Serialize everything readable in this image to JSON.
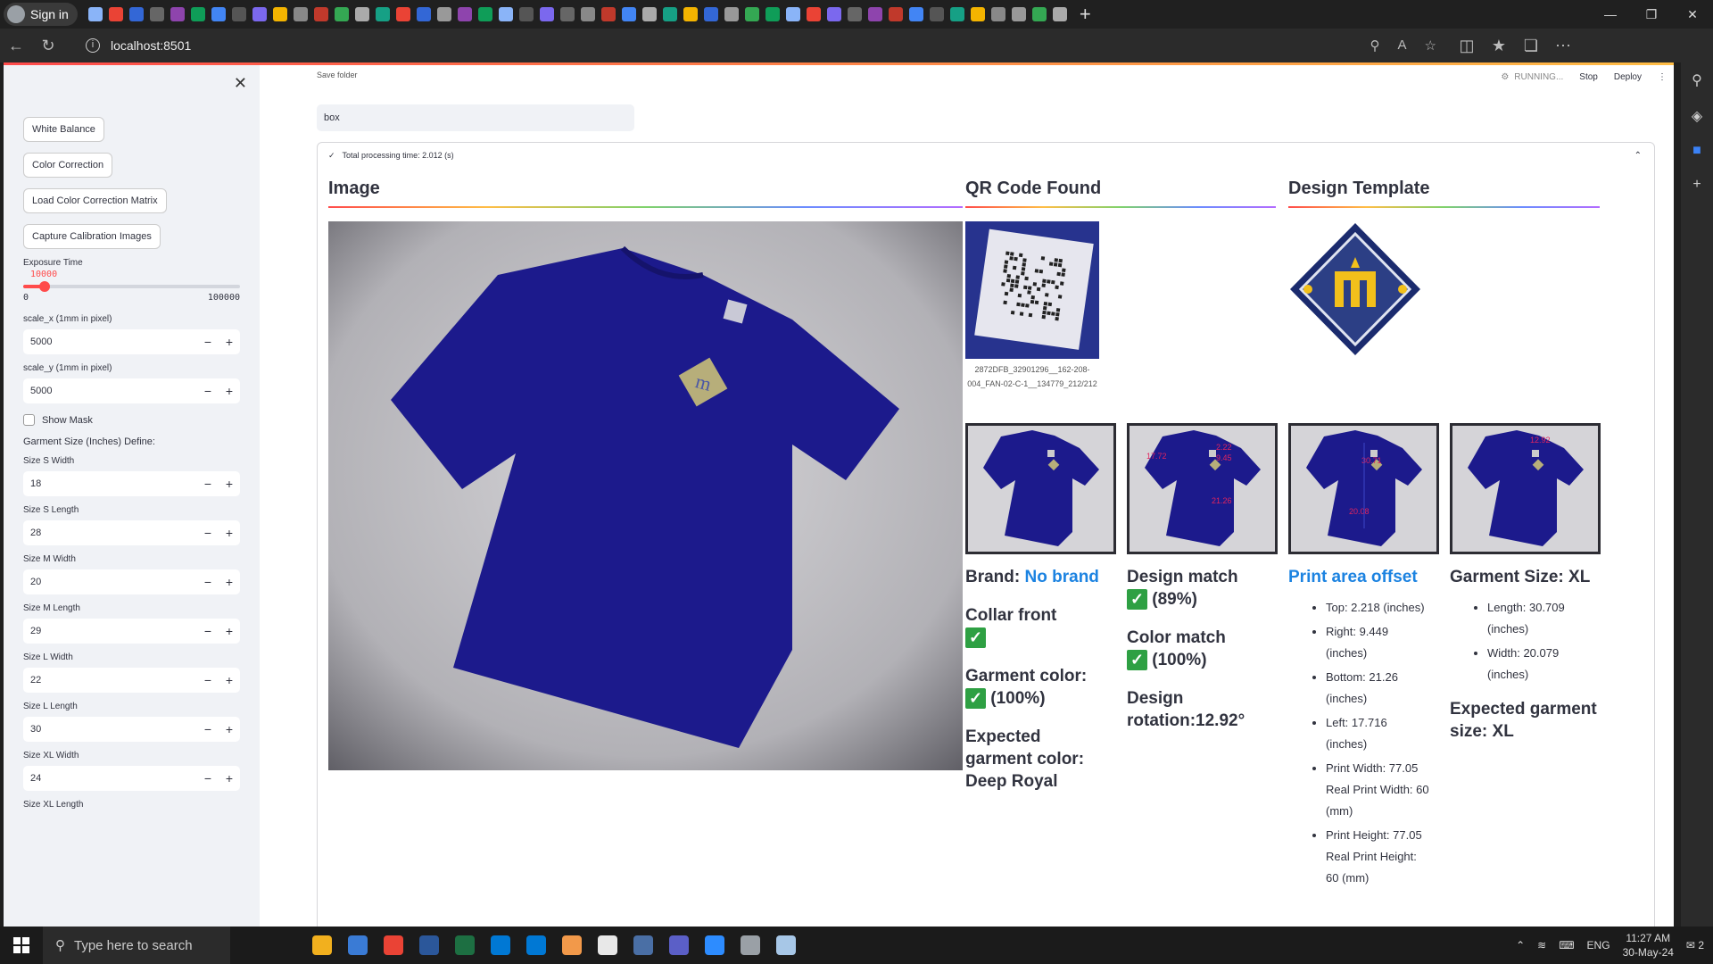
{
  "browser": {
    "signin_label": "Sign in",
    "url": "localhost:8501",
    "tab_icon_colors": [
      "#8ab4f8",
      "#666",
      "#4285f4",
      "#f4b400",
      "#34a853",
      "#ea4335",
      "#8e44ad",
      "#555",
      "#888",
      "#aaa",
      "#3367d6",
      "#0f9d58",
      "#7b68ee",
      "#c0392b",
      "#16a085",
      "#999"
    ]
  },
  "sidebar": {
    "buttons": {
      "white_balance": "White Balance",
      "color_correction": "Color Correction",
      "load_ccm": "Load Color Correction Matrix",
      "capture": "Capture Calibration Images"
    },
    "exposure": {
      "label": "Exposure Time",
      "value": "10000",
      "min": "0",
      "max": "100000",
      "fraction": 0.1
    },
    "scale_x": {
      "label": "scale_x (1mm in pixel)",
      "value": "5000"
    },
    "scale_y": {
      "label": "scale_y (1mm in pixel)",
      "value": "5000"
    },
    "show_mask_label": "Show Mask",
    "garment_section": "Garment Size (Inches) Define:",
    "sizes": [
      {
        "label": "Size S Width",
        "value": "18"
      },
      {
        "label": "Size S Length",
        "value": "28"
      },
      {
        "label": "Size M Width",
        "value": "20"
      },
      {
        "label": "Size M Length",
        "value": "29"
      },
      {
        "label": "Size L Width",
        "value": "22"
      },
      {
        "label": "Size L Length",
        "value": "30"
      },
      {
        "label": "Size XL Width",
        "value": "24"
      }
    ],
    "last_label": "Size XL Length"
  },
  "toolbar": {
    "status": "RUNNING...",
    "stop": "Stop",
    "deploy": "Deploy"
  },
  "main": {
    "save_label": "Save folder",
    "save_value": "box",
    "processing": "Total processing time: 2.012 (s)",
    "headers": {
      "image": "Image",
      "qr": "QR Code Found",
      "design": "Design Template"
    },
    "qr_caption": "2872DFB_32901296__162-208-004_FAN-02-C-1__134779_212/212",
    "brand_label": "Brand:",
    "brand_value": "No brand",
    "collar": "Collar front",
    "garment_color": "Garment color:",
    "garment_color_pct": "(100%)",
    "expected_color": "Expected garment color: Deep Royal",
    "design_match": "Design match",
    "design_match_pct": "(89%)",
    "color_match": "Color match",
    "color_match_pct": "(100%)",
    "design_rotation": "Design rotation:12.92°",
    "print_offset": "Print area offset",
    "offsets": [
      "Top: 2.218 (inches)",
      "Right: 9.449 (inches)",
      "Bottom: 21.26 (inches)",
      "Left: 17.716 (inches)",
      "Print Width: 77.05 Real Print Width: 60 (mm)",
      "Print Height: 77.05 Real Print Height: 60 (mm)"
    ],
    "garment_size": "Garment Size: XL",
    "sizes_measured": [
      "Length: 30.709 (inches)",
      "Width: 20.079 (inches)"
    ],
    "expected_size": "Expected garment size: XL",
    "thumb_labels": [
      {
        "a": "17.72",
        "b": "9.45",
        "c": "21.26",
        "d": "2.22"
      },
      {
        "a": "30.71",
        "b": "20.08"
      },
      {
        "a": "12.92"
      }
    ]
  },
  "taskbar": {
    "search_placeholder": "Type here to search",
    "time": "11:27 AM",
    "date": "30-May-24",
    "lang": "ENG",
    "notif": "2"
  }
}
